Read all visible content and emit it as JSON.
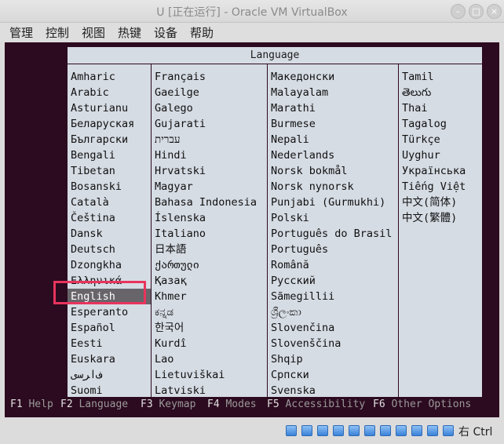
{
  "window": {
    "title": "U [正在运行] - Oracle VM VirtualBox"
  },
  "menubar": [
    "管理",
    "控制",
    "视图",
    "热键",
    "设备",
    "帮助"
  ],
  "boot_menu": {
    "header": "Language",
    "selected": "English",
    "columns": [
      [
        "Amharic",
        "Arabic",
        "Asturianu",
        "Беларуская",
        "Български",
        "Bengali",
        "Tibetan",
        "Bosanski",
        "Català",
        "Čeština",
        "Dansk",
        "Deutsch",
        "Dzongkha",
        "Ελληνικά",
        "English",
        "Esperanto",
        "Español",
        "Eesti",
        "Euskara",
        "ﻑﺍﺮﺳی",
        "Suomi"
      ],
      [
        "Français",
        "Gaeilge",
        "Galego",
        "Gujarati",
        "עברית",
        "Hindi",
        "Hrvatski",
        "Magyar",
        "Bahasa Indonesia",
        "Íslenska",
        "Italiano",
        "日本語",
        "ქართული",
        "Қазақ",
        "Khmer",
        "ಕನ್ನಡ",
        "한국어",
        "Kurdî",
        "Lao",
        "Lietuviškai",
        "Latviski"
      ],
      [
        "Македонски",
        "Malayalam",
        "Marathi",
        "Burmese",
        "Nepali",
        "Nederlands",
        "Norsk bokmål",
        "Norsk nynorsk",
        "Punjabi (Gurmukhi)",
        "Polski",
        "Português do Brasil",
        "Português",
        "Română",
        "Русский",
        "Sãmegillii",
        "ශ්‍රීලංකා",
        "Slovenčina",
        "Slovenščina",
        "Shqip",
        "Српски",
        "Svenska"
      ],
      [
        "Tamil",
        "తెలుగు",
        "Thai",
        "Tagalog",
        "Türkçe",
        "Uyghur",
        "Українська",
        "Tiếng Việt",
        "中文(简体)",
        "中文(繁體)"
      ]
    ]
  },
  "function_keys": [
    {
      "key": "F1",
      "label": "Help"
    },
    {
      "key": "F2",
      "label": "Language"
    },
    {
      "key": "F3",
      "label": "Keymap"
    },
    {
      "key": "F4",
      "label": "Modes"
    },
    {
      "key": "F5",
      "label": "Accessibility"
    },
    {
      "key": "F6",
      "label": "Other Options"
    }
  ],
  "statusbar": {
    "host_key": "右 Ctrl",
    "icons": [
      "hard-disk-icon",
      "optical-drive-icon",
      "audio-icon",
      "network-icon",
      "usb-icon",
      "shared-folders-icon",
      "display-icon",
      "video-capture-icon",
      "virtualization-icon",
      "mouse-integration-icon",
      "keyboard-capture-icon"
    ]
  },
  "colors": {
    "screen_bg": "#2c0a1f",
    "menu_bg": "#d6dce4",
    "selected_bg": "#68656a",
    "annotation_box": "#e8345d"
  }
}
